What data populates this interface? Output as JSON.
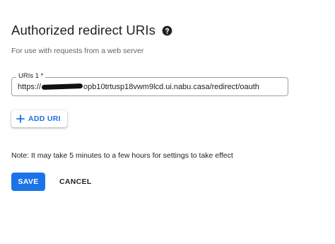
{
  "section": {
    "title": "Authorized redirect URIs",
    "help_icon": "help-circle-icon",
    "subtitle": "For use with requests from a web server"
  },
  "uri_field": {
    "label": "URIs 1 *",
    "value_prefix": "https://",
    "value_suffix": "opb10trtusp18vwm9lcd.ui.nabu.casa/redirect/oauth",
    "redacted": true
  },
  "add_uri": {
    "icon": "plus-icon",
    "label": "ADD URI"
  },
  "note": "Note: It may take 5 minutes to a few hours for settings to take effect",
  "actions": {
    "save_label": "SAVE",
    "cancel_label": "CANCEL"
  },
  "colors": {
    "accent": "#1a73e8",
    "text": "#202124",
    "muted": "#5f6368"
  }
}
